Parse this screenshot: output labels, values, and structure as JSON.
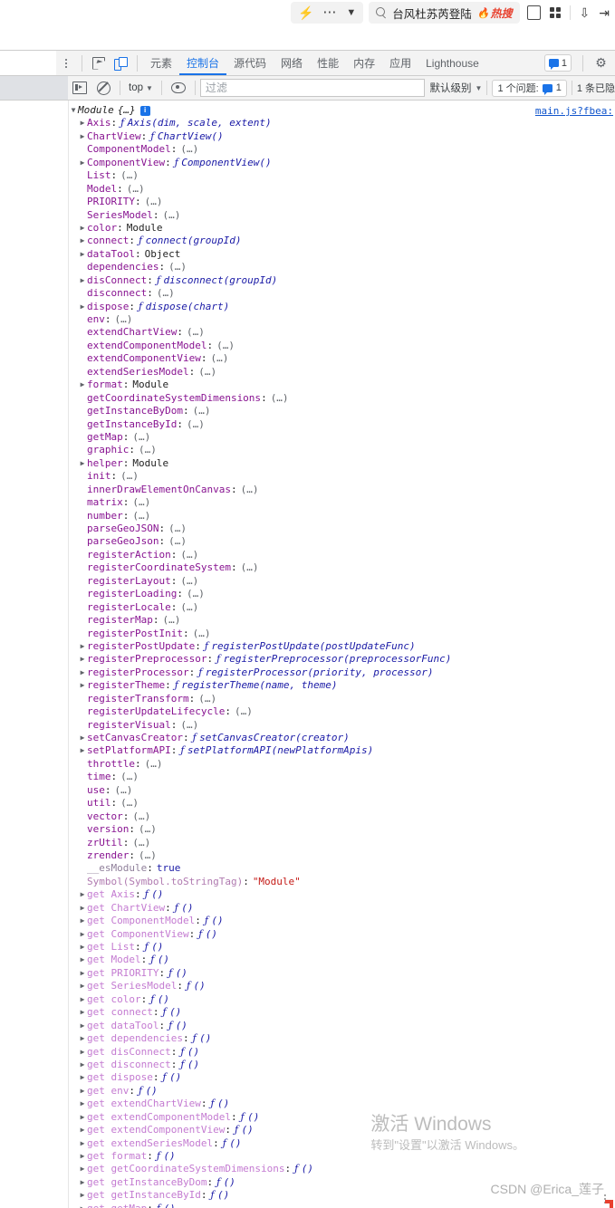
{
  "browser": {
    "quick_icons": [
      "bolt-icon",
      "more-icon",
      "chevron-down-icon"
    ],
    "search": {
      "icon": "search-icon",
      "text": "台风杜苏芮登陆",
      "hot_label": "热搜",
      "hot_icon": "flame-icon"
    },
    "right_icons": [
      "collections-icon",
      "apps-grid-icon",
      "download-icon",
      "share-icon"
    ]
  },
  "devtools": {
    "kebab_menu": "more-tools-icon",
    "inspect_icon": "inspect-element-icon",
    "device_icon": "device-toolbar-icon",
    "tabs": [
      {
        "label": "元素",
        "active": false
      },
      {
        "label": "控制台",
        "active": true
      },
      {
        "label": "源代码",
        "active": false
      },
      {
        "label": "网络",
        "active": false
      },
      {
        "label": "性能",
        "active": false
      },
      {
        "label": "内存",
        "active": false
      },
      {
        "label": "应用",
        "active": false
      },
      {
        "label": "Lighthouse",
        "active": false
      }
    ],
    "issues_count": "1",
    "settings_icon": "gear-icon",
    "filterbar": {
      "sidebar_icon": "console-sidebar-icon",
      "clear_icon": "clear-console-icon",
      "context": "top",
      "eye_icon": "live-expression-icon",
      "filter_placeholder": "过滤",
      "level": "默认级别",
      "issues_label": "1 个问题:",
      "issues_value": "1",
      "hidden_label": "1 条已隐"
    },
    "source_link": "main.js?fbea:"
  },
  "console": {
    "header": {
      "type": "Module",
      "preview": "{…}",
      "info_badge": "i"
    },
    "properties": [
      {
        "indent": 1,
        "expandable": true,
        "name": "Axis",
        "value": "Axis(dim, scale, extent)",
        "kind": "fn"
      },
      {
        "indent": 1,
        "expandable": true,
        "name": "ChartView",
        "value": "ChartView()",
        "kind": "fn"
      },
      {
        "indent": 1,
        "expandable": false,
        "name": "ComponentModel",
        "value": "(…)",
        "kind": "dots"
      },
      {
        "indent": 1,
        "expandable": true,
        "name": "ComponentView",
        "value": "ComponentView()",
        "kind": "fn"
      },
      {
        "indent": 1,
        "expandable": false,
        "name": "List",
        "value": "(…)",
        "kind": "dots"
      },
      {
        "indent": 1,
        "expandable": false,
        "name": "Model",
        "value": "(…)",
        "kind": "dots"
      },
      {
        "indent": 1,
        "expandable": false,
        "name": "PRIORITY",
        "value": "(…)",
        "kind": "dots"
      },
      {
        "indent": 1,
        "expandable": false,
        "name": "SeriesModel",
        "value": "(…)",
        "kind": "dots"
      },
      {
        "indent": 1,
        "expandable": true,
        "name": "color",
        "value": "Module",
        "kind": "mod"
      },
      {
        "indent": 1,
        "expandable": true,
        "name": "connect",
        "value": "connect(groupId)",
        "kind": "fn"
      },
      {
        "indent": 1,
        "expandable": true,
        "name": "dataTool",
        "value": "Object",
        "kind": "mod"
      },
      {
        "indent": 1,
        "expandable": false,
        "name": "dependencies",
        "value": "(…)",
        "kind": "dots"
      },
      {
        "indent": 1,
        "expandable": true,
        "name": "disConnect",
        "value": "disconnect(groupId)",
        "kind": "fn"
      },
      {
        "indent": 1,
        "expandable": false,
        "name": "disconnect",
        "value": "(…)",
        "kind": "dots"
      },
      {
        "indent": 1,
        "expandable": true,
        "name": "dispose",
        "value": "dispose(chart)",
        "kind": "fn"
      },
      {
        "indent": 1,
        "expandable": false,
        "name": "env",
        "value": "(…)",
        "kind": "dots"
      },
      {
        "indent": 1,
        "expandable": false,
        "name": "extendChartView",
        "value": "(…)",
        "kind": "dots"
      },
      {
        "indent": 1,
        "expandable": false,
        "name": "extendComponentModel",
        "value": "(…)",
        "kind": "dots"
      },
      {
        "indent": 1,
        "expandable": false,
        "name": "extendComponentView",
        "value": "(…)",
        "kind": "dots"
      },
      {
        "indent": 1,
        "expandable": false,
        "name": "extendSeriesModel",
        "value": "(…)",
        "kind": "dots"
      },
      {
        "indent": 1,
        "expandable": true,
        "name": "format",
        "value": "Module",
        "kind": "mod"
      },
      {
        "indent": 1,
        "expandable": false,
        "name": "getCoordinateSystemDimensions",
        "value": "(…)",
        "kind": "dots"
      },
      {
        "indent": 1,
        "expandable": false,
        "name": "getInstanceByDom",
        "value": "(…)",
        "kind": "dots"
      },
      {
        "indent": 1,
        "expandable": false,
        "name": "getInstanceById",
        "value": "(…)",
        "kind": "dots"
      },
      {
        "indent": 1,
        "expandable": false,
        "name": "getMap",
        "value": "(…)",
        "kind": "dots"
      },
      {
        "indent": 1,
        "expandable": false,
        "name": "graphic",
        "value": "(…)",
        "kind": "dots"
      },
      {
        "indent": 1,
        "expandable": true,
        "name": "helper",
        "value": "Module",
        "kind": "mod"
      },
      {
        "indent": 1,
        "expandable": false,
        "name": "init",
        "value": "(…)",
        "kind": "dots"
      },
      {
        "indent": 1,
        "expandable": false,
        "name": "innerDrawElementOnCanvas",
        "value": "(…)",
        "kind": "dots"
      },
      {
        "indent": 1,
        "expandable": false,
        "name": "matrix",
        "value": "(…)",
        "kind": "dots"
      },
      {
        "indent": 1,
        "expandable": false,
        "name": "number",
        "value": "(…)",
        "kind": "dots"
      },
      {
        "indent": 1,
        "expandable": false,
        "name": "parseGeoJSON",
        "value": "(…)",
        "kind": "dots"
      },
      {
        "indent": 1,
        "expandable": false,
        "name": "parseGeoJson",
        "value": "(…)",
        "kind": "dots"
      },
      {
        "indent": 1,
        "expandable": false,
        "name": "registerAction",
        "value": "(…)",
        "kind": "dots"
      },
      {
        "indent": 1,
        "expandable": false,
        "name": "registerCoordinateSystem",
        "value": "(…)",
        "kind": "dots"
      },
      {
        "indent": 1,
        "expandable": false,
        "name": "registerLayout",
        "value": "(…)",
        "kind": "dots"
      },
      {
        "indent": 1,
        "expandable": false,
        "name": "registerLoading",
        "value": "(…)",
        "kind": "dots"
      },
      {
        "indent": 1,
        "expandable": false,
        "name": "registerLocale",
        "value": "(…)",
        "kind": "dots"
      },
      {
        "indent": 1,
        "expandable": false,
        "name": "registerMap",
        "value": "(…)",
        "kind": "dots"
      },
      {
        "indent": 1,
        "expandable": false,
        "name": "registerPostInit",
        "value": "(…)",
        "kind": "dots"
      },
      {
        "indent": 1,
        "expandable": true,
        "name": "registerPostUpdate",
        "value": "registerPostUpdate(postUpdateFunc)",
        "kind": "fn"
      },
      {
        "indent": 1,
        "expandable": true,
        "name": "registerPreprocessor",
        "value": "registerPreprocessor(preprocessorFunc)",
        "kind": "fn"
      },
      {
        "indent": 1,
        "expandable": true,
        "name": "registerProcessor",
        "value": "registerProcessor(priority, processor)",
        "kind": "fn"
      },
      {
        "indent": 1,
        "expandable": true,
        "name": "registerTheme",
        "value": "registerTheme(name, theme)",
        "kind": "fn"
      },
      {
        "indent": 1,
        "expandable": false,
        "name": "registerTransform",
        "value": "(…)",
        "kind": "dots"
      },
      {
        "indent": 1,
        "expandable": false,
        "name": "registerUpdateLifecycle",
        "value": "(…)",
        "kind": "dots"
      },
      {
        "indent": 1,
        "expandable": false,
        "name": "registerVisual",
        "value": "(…)",
        "kind": "dots"
      },
      {
        "indent": 1,
        "expandable": true,
        "name": "setCanvasCreator",
        "value": "setCanvasCreator(creator)",
        "kind": "fn"
      },
      {
        "indent": 1,
        "expandable": true,
        "name": "setPlatformAPI",
        "value": "setPlatformAPI(newPlatformApis)",
        "kind": "fn"
      },
      {
        "indent": 1,
        "expandable": false,
        "name": "throttle",
        "value": "(…)",
        "kind": "dots"
      },
      {
        "indent": 1,
        "expandable": false,
        "name": "time",
        "value": "(…)",
        "kind": "dots"
      },
      {
        "indent": 1,
        "expandable": false,
        "name": "use",
        "value": "(…)",
        "kind": "dots"
      },
      {
        "indent": 1,
        "expandable": false,
        "name": "util",
        "value": "(…)",
        "kind": "dots"
      },
      {
        "indent": 1,
        "expandable": false,
        "name": "vector",
        "value": "(…)",
        "kind": "dots"
      },
      {
        "indent": 1,
        "expandable": false,
        "name": "version",
        "value": "(…)",
        "kind": "dots"
      },
      {
        "indent": 1,
        "expandable": false,
        "name": "zrUtil",
        "value": "(…)",
        "kind": "dots"
      },
      {
        "indent": 1,
        "expandable": false,
        "name": "zrender",
        "value": "(…)",
        "kind": "dots"
      },
      {
        "indent": 1,
        "expandable": false,
        "name": "__esModule",
        "value": "true",
        "kind": "bool",
        "dim": true
      },
      {
        "indent": 1,
        "expandable": false,
        "name": "Symbol(Symbol.toStringTag)",
        "value": "\"Module\"",
        "kind": "str",
        "dim": true
      },
      {
        "indent": 1,
        "expandable": true,
        "getter": true,
        "name": "Axis",
        "value": "()",
        "kind": "fn"
      },
      {
        "indent": 1,
        "expandable": true,
        "getter": true,
        "name": "ChartView",
        "value": "()",
        "kind": "fn"
      },
      {
        "indent": 1,
        "expandable": true,
        "getter": true,
        "name": "ComponentModel",
        "value": "()",
        "kind": "fn"
      },
      {
        "indent": 1,
        "expandable": true,
        "getter": true,
        "name": "ComponentView",
        "value": "()",
        "kind": "fn"
      },
      {
        "indent": 1,
        "expandable": true,
        "getter": true,
        "name": "List",
        "value": "()",
        "kind": "fn"
      },
      {
        "indent": 1,
        "expandable": true,
        "getter": true,
        "name": "Model",
        "value": "()",
        "kind": "fn"
      },
      {
        "indent": 1,
        "expandable": true,
        "getter": true,
        "name": "PRIORITY",
        "value": "()",
        "kind": "fn"
      },
      {
        "indent": 1,
        "expandable": true,
        "getter": true,
        "name": "SeriesModel",
        "value": "()",
        "kind": "fn"
      },
      {
        "indent": 1,
        "expandable": true,
        "getter": true,
        "name": "color",
        "value": "()",
        "kind": "fn"
      },
      {
        "indent": 1,
        "expandable": true,
        "getter": true,
        "name": "connect",
        "value": "()",
        "kind": "fn"
      },
      {
        "indent": 1,
        "expandable": true,
        "getter": true,
        "name": "dataTool",
        "value": "()",
        "kind": "fn"
      },
      {
        "indent": 1,
        "expandable": true,
        "getter": true,
        "name": "dependencies",
        "value": "()",
        "kind": "fn"
      },
      {
        "indent": 1,
        "expandable": true,
        "getter": true,
        "name": "disConnect",
        "value": "()",
        "kind": "fn"
      },
      {
        "indent": 1,
        "expandable": true,
        "getter": true,
        "name": "disconnect",
        "value": "()",
        "kind": "fn"
      },
      {
        "indent": 1,
        "expandable": true,
        "getter": true,
        "name": "dispose",
        "value": "()",
        "kind": "fn"
      },
      {
        "indent": 1,
        "expandable": true,
        "getter": true,
        "name": "env",
        "value": "()",
        "kind": "fn"
      },
      {
        "indent": 1,
        "expandable": true,
        "getter": true,
        "name": "extendChartView",
        "value": "()",
        "kind": "fn"
      },
      {
        "indent": 1,
        "expandable": true,
        "getter": true,
        "name": "extendComponentModel",
        "value": "()",
        "kind": "fn"
      },
      {
        "indent": 1,
        "expandable": true,
        "getter": true,
        "name": "extendComponentView",
        "value": "()",
        "kind": "fn"
      },
      {
        "indent": 1,
        "expandable": true,
        "getter": true,
        "name": "extendSeriesModel",
        "value": "()",
        "kind": "fn"
      },
      {
        "indent": 1,
        "expandable": true,
        "getter": true,
        "name": "format",
        "value": "()",
        "kind": "fn"
      },
      {
        "indent": 1,
        "expandable": true,
        "getter": true,
        "name": "getCoordinateSystemDimensions",
        "value": "()",
        "kind": "fn"
      },
      {
        "indent": 1,
        "expandable": true,
        "getter": true,
        "name": "getInstanceByDom",
        "value": "()",
        "kind": "fn"
      },
      {
        "indent": 1,
        "expandable": true,
        "getter": true,
        "name": "getInstanceById",
        "value": "()",
        "kind": "fn"
      },
      {
        "indent": 1,
        "expandable": true,
        "getter": true,
        "name": "getMap",
        "value": "()",
        "kind": "fn"
      }
    ]
  },
  "watermark": {
    "title": "激活 Windows",
    "subtitle": "转到\"设置\"以激活 Windows。"
  },
  "csdn_credit": "CSDN @Erica_莲子",
  "colors": {
    "accent": "#1a73e8",
    "property_name": "#881391",
    "getter_name": "#c47bd1",
    "function_value": "#1a1aa6",
    "string_value": "#c41a16",
    "link": "#1155cc",
    "hot_red": "#e8412f"
  }
}
